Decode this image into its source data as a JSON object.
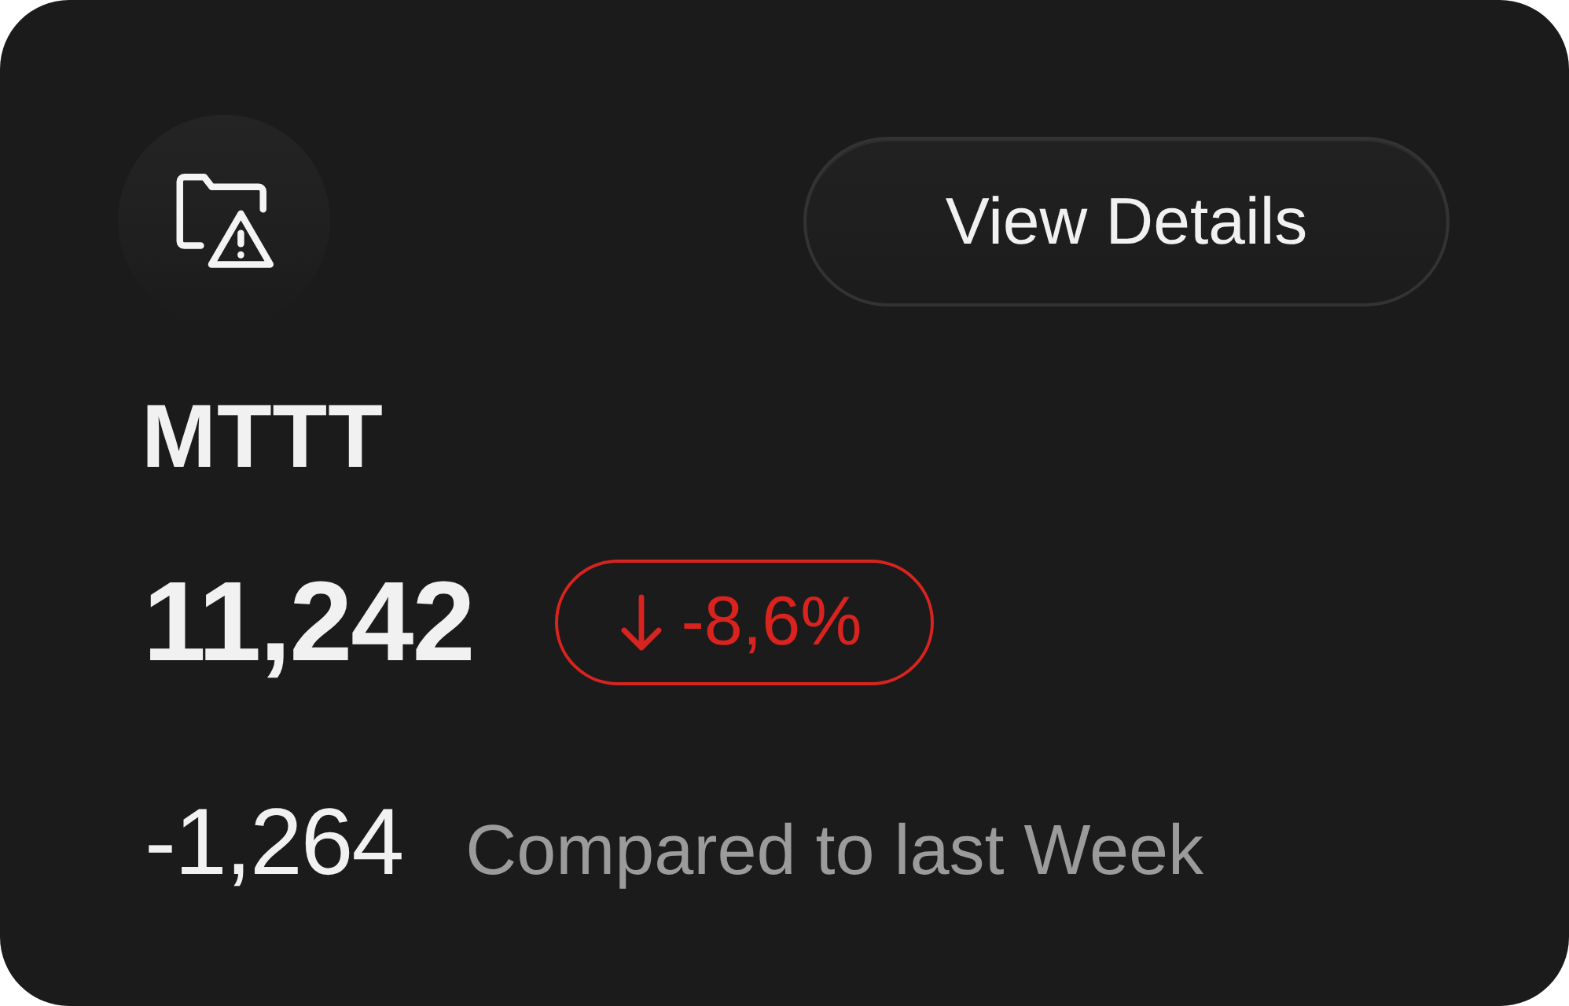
{
  "button": {
    "label": "View Details"
  },
  "metric": {
    "title": "MTTT",
    "value": "11,242",
    "change": {
      "negative": true,
      "text": "-8,6%"
    }
  },
  "comparison": {
    "delta": "-1,264",
    "label": "Compared to last Week"
  }
}
